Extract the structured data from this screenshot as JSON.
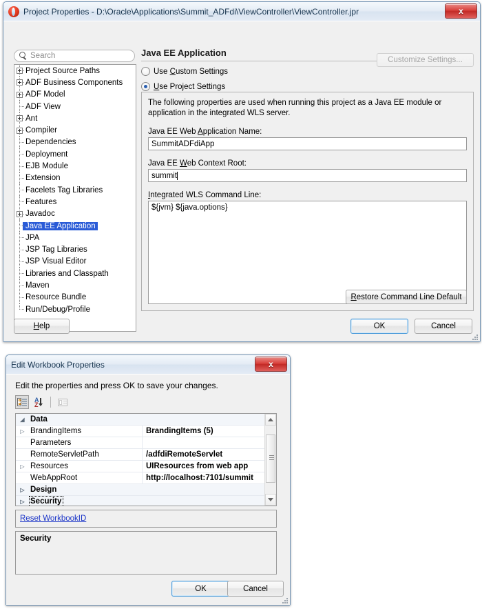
{
  "project_dialog": {
    "icon": "oracle-jdeveloper-icon",
    "title": "Project Properties - D:\\Oracle\\Applications\\Summit_ADFdi\\ViewController\\ViewController.jpr",
    "close_label": "x",
    "search": {
      "placeholder": "Search",
      "value": "",
      "icon": "search-icon"
    },
    "tree": [
      {
        "label": "Project Source Paths",
        "expandable": true,
        "selected": false
      },
      {
        "label": "ADF Business Components",
        "expandable": true,
        "selected": false
      },
      {
        "label": "ADF Model",
        "expandable": true,
        "selected": false
      },
      {
        "label": "ADF View",
        "expandable": false,
        "selected": false
      },
      {
        "label": "Ant",
        "expandable": true,
        "selected": false
      },
      {
        "label": "Compiler",
        "expandable": true,
        "selected": false
      },
      {
        "label": "Dependencies",
        "expandable": false,
        "selected": false
      },
      {
        "label": "Deployment",
        "expandable": false,
        "selected": false
      },
      {
        "label": "EJB Module",
        "expandable": false,
        "selected": false
      },
      {
        "label": "Extension",
        "expandable": false,
        "selected": false
      },
      {
        "label": "Facelets Tag Libraries",
        "expandable": false,
        "selected": false
      },
      {
        "label": "Features",
        "expandable": false,
        "selected": false
      },
      {
        "label": "Javadoc",
        "expandable": true,
        "selected": false
      },
      {
        "label": "Java EE Application",
        "expandable": false,
        "selected": true
      },
      {
        "label": "JPA",
        "expandable": false,
        "selected": false
      },
      {
        "label": "JSP Tag Libraries",
        "expandable": false,
        "selected": false
      },
      {
        "label": "JSP Visual Editor",
        "expandable": false,
        "selected": false
      },
      {
        "label": "Libraries and Classpath",
        "expandable": false,
        "selected": false
      },
      {
        "label": "Maven",
        "expandable": false,
        "selected": false
      },
      {
        "label": "Resource Bundle",
        "expandable": false,
        "selected": false
      },
      {
        "label": "Run/Debug/Profile",
        "expandable": false,
        "selected": false
      }
    ],
    "panel": {
      "title": "Java EE Application",
      "radio_custom": "Use Custom Settings",
      "radio_project": "Use Project Settings",
      "selected_radio": "project",
      "customize_button": "Customize Settings...",
      "customize_enabled": false,
      "description": "The following properties are used when running this project as a Java EE module or application in the integrated WLS server.",
      "app_name_label": "Java EE Web Application Name:",
      "app_name_value": "SummitADFdiApp",
      "context_root_label": "Java EE Web Context Root:",
      "context_root_value": "summit",
      "command_line_label": "Integrated WLS Command Line:",
      "command_line_value": "${jvm} ${java.options}",
      "restore_button": "Restore Command Line Default"
    },
    "footer": {
      "help": "Help",
      "ok": "OK",
      "cancel": "Cancel"
    }
  },
  "workbook_dialog": {
    "title": "Edit Workbook Properties",
    "close_label": "x",
    "intro": "Edit the properties and press OK to save your changes.",
    "toolbar": [
      {
        "name": "categorized-view-icon",
        "pressed": true
      },
      {
        "name": "sort-alphabetical-icon",
        "pressed": false
      },
      {
        "name": "property-pages-icon",
        "pressed": false,
        "enabled": false
      }
    ],
    "grid": [
      {
        "kind": "category",
        "arrow": "◢",
        "name": "Data",
        "value": ""
      },
      {
        "kind": "prop",
        "arrow": "▷",
        "name": "BrandingItems",
        "value": "BrandingItems (5)"
      },
      {
        "kind": "prop",
        "arrow": "",
        "name": "Parameters",
        "value": ""
      },
      {
        "kind": "prop",
        "arrow": "",
        "name": "RemoteServletPath",
        "value": "/adfdiRemoteServlet"
      },
      {
        "kind": "prop",
        "arrow": "▷",
        "name": "Resources",
        "value": "UIResources from web app"
      },
      {
        "kind": "prop",
        "arrow": "",
        "name": "WebAppRoot",
        "value": "http://localhost:7101/summit"
      },
      {
        "kind": "category",
        "arrow": "▷",
        "name": "Design",
        "value": ""
      },
      {
        "kind": "category",
        "arrow": "▷",
        "name": "Security",
        "value": "",
        "focused": true
      }
    ],
    "reset_link": "Reset WorkbookID",
    "description_title": "Security",
    "ok": "OK",
    "cancel": "Cancel"
  }
}
